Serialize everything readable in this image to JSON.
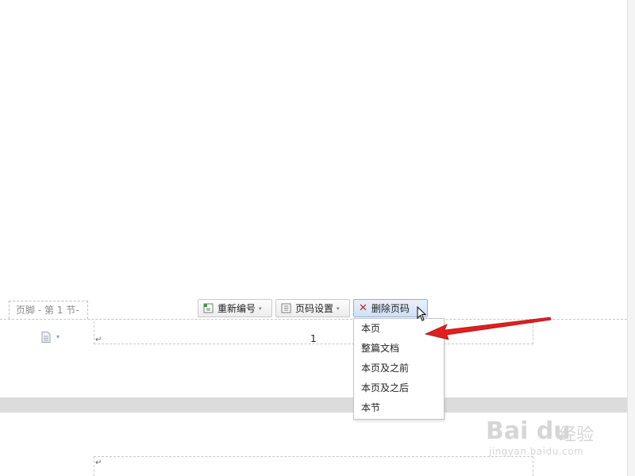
{
  "footer": {
    "tag_label": "页脚 - 第 1 节-",
    "page_number": "1",
    "paragraph_mark": "↵"
  },
  "toolbar": {
    "renumber_label": "重新编号",
    "page_setup_label": "页码设置",
    "delete_label": "删除页码",
    "caret": "▾"
  },
  "delete_menu": {
    "items": [
      "本页",
      "整篇文档",
      "本页及之前",
      "本页及之后",
      "本节"
    ]
  },
  "watermark": {
    "brand": "Bai du",
    "jingyan": "经验",
    "url": "jingyan.baidu.com"
  },
  "colors": {
    "annotation_arrow": "#e02020",
    "delete_icon": "#d21f1f"
  }
}
